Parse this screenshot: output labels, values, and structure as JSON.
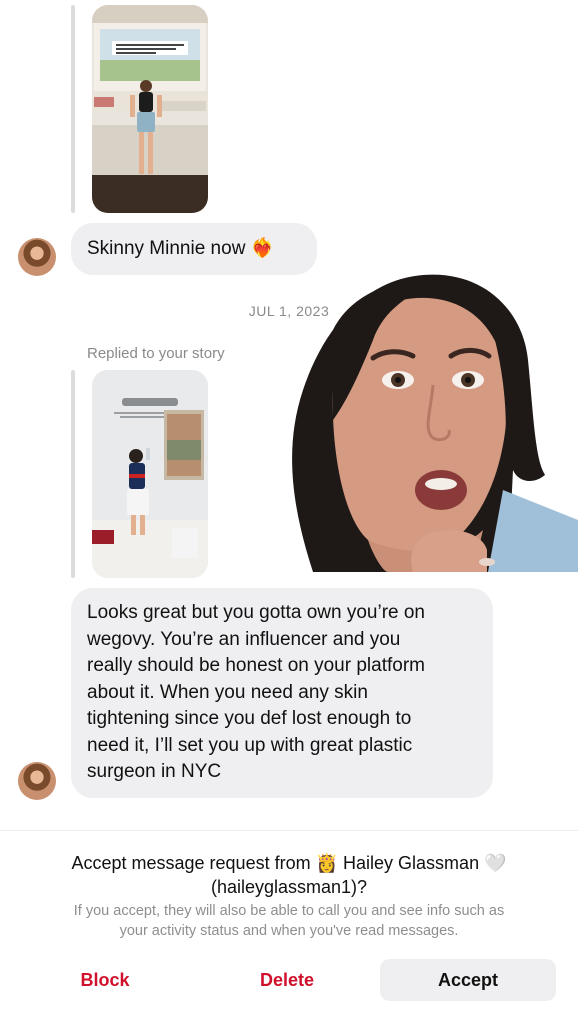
{
  "thread": {
    "messages": [
      {
        "type": "story_reply",
        "sender": "them"
      },
      {
        "type": "text",
        "sender": "them",
        "text": "Skinny Minnie now ❤️‍🔥"
      },
      {
        "type": "date_separator",
        "text": "JUL 1, 2023"
      },
      {
        "type": "story_reply",
        "sender": "them",
        "label": "Replied to your story"
      },
      {
        "type": "text",
        "sender": "them",
        "lines": [
          "Looks great but you gotta own you’re on",
          "wegovy. You’re an influencer and you",
          "really should be honest on your platform",
          "about it. When you need any skin",
          "tightening since you def lost enough to",
          "need it, I’ll set you up with great plastic",
          "surgeon in NYC"
        ]
      }
    ]
  },
  "story1": {
    "caption": "I somehow forgot a BATHING SUIT so until Amazon delivers me one, this is the fit for the pool"
  },
  "request": {
    "title_prefix": "Accept message request from",
    "user_emoji": "👸",
    "name": "Hailey Glassman",
    "name_emoji": "🤍",
    "handle": "(haileyglassman1)?",
    "subtitle_lines": [
      "If you accept, they will also be able to call you and see info such as",
      "your activity status and when you've read messages."
    ]
  },
  "actions": {
    "block": "Block",
    "delete": "Delete",
    "accept": "Accept"
  },
  "colors": {
    "danger": "#d0112b",
    "bubble": "#efeff1",
    "muted": "#8e8e8e"
  }
}
